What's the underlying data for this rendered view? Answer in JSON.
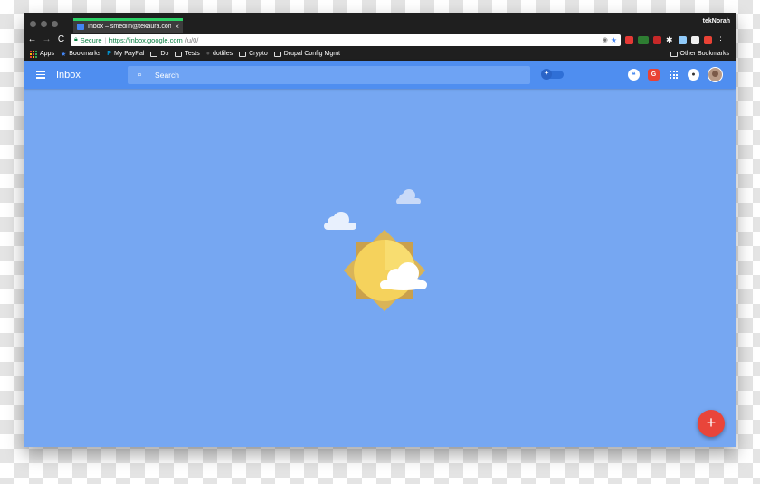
{
  "browser": {
    "tab_title": "Inbox – smedlin@tekaura.com",
    "tab_close": "×",
    "profile_name": "tekNorah",
    "nav": {
      "back": "←",
      "forward": "→",
      "reload": "C"
    },
    "omnibox": {
      "secure_label": "Secure",
      "url_scheme_host": "https://inbox.google.com",
      "url_path": "/u/0/"
    },
    "menu_glyph": "⋮"
  },
  "bookmarks": [
    {
      "label": "Apps",
      "icon": "apps-grid-icon"
    },
    {
      "label": "Bookmarks",
      "icon": "star-icon"
    },
    {
      "label": "My PayPal",
      "icon": "paypal-icon"
    },
    {
      "label": "Do",
      "icon": "folder-icon"
    },
    {
      "label": "Tests",
      "icon": "folder-icon"
    },
    {
      "label": "dotfiles",
      "icon": "github-icon"
    },
    {
      "label": "Crypto",
      "icon": "folder-icon"
    },
    {
      "label": "Drupal Config Mgmt",
      "icon": "folder-icon"
    }
  ],
  "other_bookmarks": "Other Bookmarks",
  "inbox": {
    "brand": "Inbox",
    "search_placeholder": "Search",
    "pin_glyph": "✦",
    "hangout_glyph": "❝",
    "grammarly_glyph": "G",
    "fab_glyph": "+"
  },
  "colors": {
    "app_bar": "#4f8ef0",
    "background": "#76a7f2",
    "fab": "#e9453a"
  }
}
